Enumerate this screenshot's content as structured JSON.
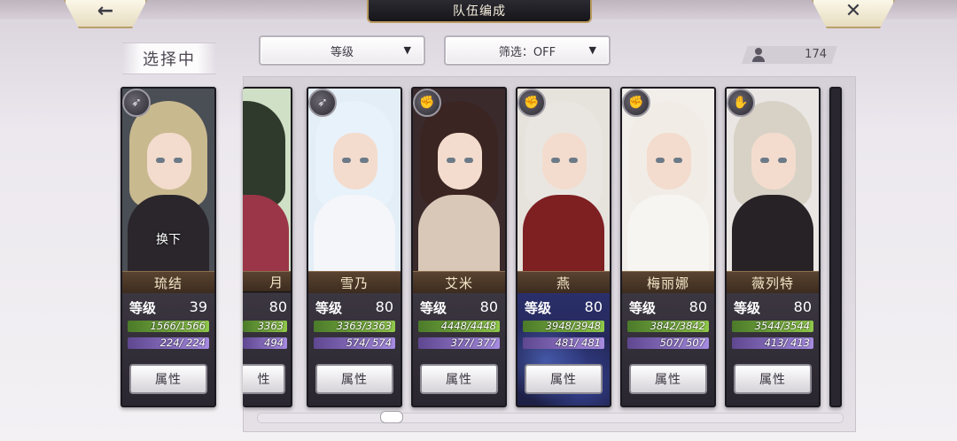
{
  "header": {
    "title": "队伍编成",
    "back_icon": "left-arrow-icon",
    "close_icon": "close-x-icon"
  },
  "selecting_label": "选择中",
  "sort_dropdown": {
    "label": "等级"
  },
  "filter_dropdown": {
    "label": "筛选：OFF"
  },
  "unit_count": "174",
  "level_label": "等级",
  "attr_button_label": "属性",
  "swap_label": "换下",
  "selected_card": {
    "name": "琉结",
    "level": "39",
    "hp": "1566/1566",
    "sp": "224/ 224",
    "class_icon": "bow-icon",
    "colors": {
      "bg": "#4a4e55",
      "hair": "#c9b98f",
      "body": "#2a262c"
    }
  },
  "clipped_card": {
    "name_fragment": "月",
    "level": "80",
    "hp_fragment": "3363",
    "sp_fragment": "494",
    "attr_fragment": "性",
    "colors": {
      "bg": "#cfe0c6",
      "hair": "#2f3a2c",
      "body": "#9b3548"
    }
  },
  "cards": [
    {
      "name": "雪乃",
      "level": "80",
      "hp": "3363/3363",
      "sp": "574/ 574",
      "class_icon": "bow-icon",
      "colors": {
        "bg": "#e4eef6",
        "hair": "#e8f2fb",
        "body": "#f4f6fa"
      }
    },
    {
      "name": "艾米",
      "level": "80",
      "hp": "4448/4448",
      "sp": "377/ 377",
      "class_icon": "fist-icon",
      "colors": {
        "bg": "#3a2a2c",
        "hair": "#3b2522",
        "body": "#d9c7b8"
      }
    },
    {
      "name": "燕",
      "level": "80",
      "hp": "3948/3948",
      "sp": "481/ 481",
      "class_icon": "fist-icon",
      "colors": {
        "bg": "#e6e2dc",
        "hair": "#e9e6e2",
        "body": "#7e1f22"
      }
    },
    {
      "name": "梅丽娜",
      "level": "80",
      "hp": "3842/3842",
      "sp": "507/ 507",
      "class_icon": "fist-icon",
      "colors": {
        "bg": "#f2eeea",
        "hair": "#f1ede6",
        "body": "#f7f5f2"
      }
    },
    {
      "name": "薇列特",
      "level": "80",
      "hp": "3544/3544",
      "sp": "413/ 413",
      "class_icon": "gauntlet-icon",
      "colors": {
        "bg": "#e9e6e3",
        "hair": "#d8d2c6",
        "body": "#262226"
      }
    }
  ]
}
